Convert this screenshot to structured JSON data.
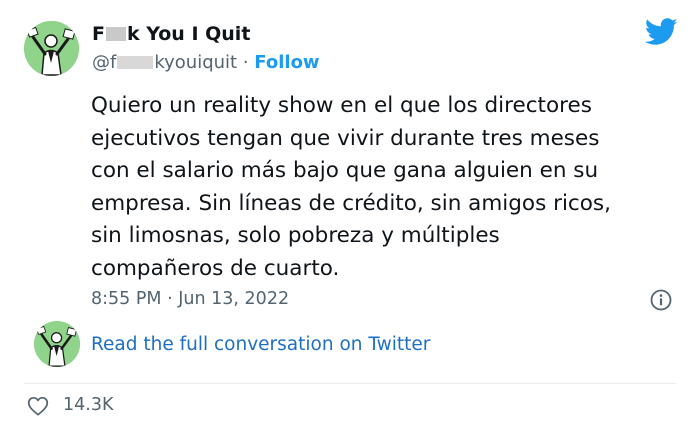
{
  "author": {
    "name_prefix": "F",
    "name_suffix": "k You I Quit",
    "handle_prefix": "@f",
    "handle_suffix": "kyouiquit",
    "separator": "·",
    "follow_label": "Follow"
  },
  "icons": {
    "brand": "twitter-bird-icon",
    "info": "info-icon",
    "like": "heart-icon",
    "brand_color": "#1d9bf0"
  },
  "tweet": {
    "lines": [
      "Quiero un reality show en el que los directores",
      "ejecutivos tengan que vivir durante tres meses",
      "con el salario más bajo que gana alguien en su",
      "empresa. Sin líneas de crédito, sin amigos ricos,",
      "sin limosnas, solo pobreza y múltiples",
      "compañeros de cuarto."
    ],
    "time": "8:55 PM",
    "separator": "·",
    "date": "Jun 13, 2022"
  },
  "conversation_link": "Read the full conversation on Twitter",
  "likes": "14.3K"
}
